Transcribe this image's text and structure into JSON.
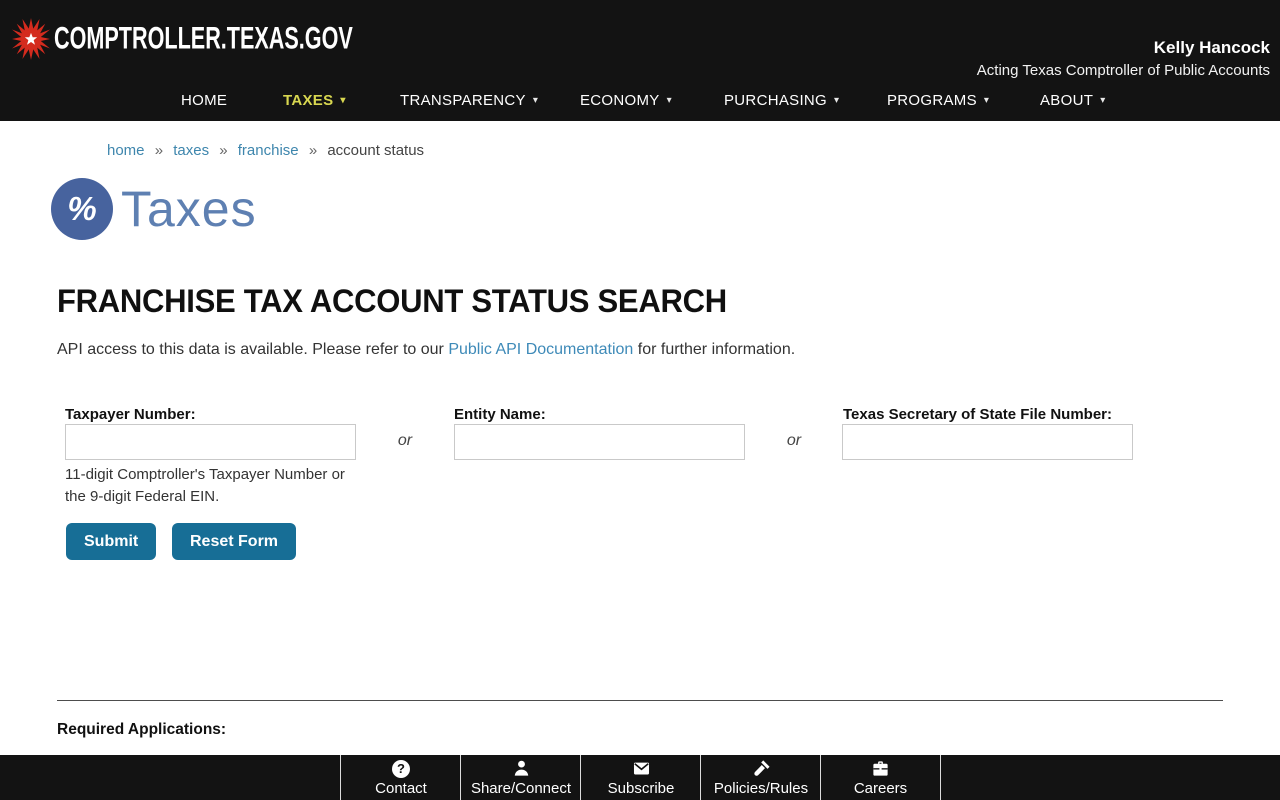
{
  "header": {
    "site_name": "COMPTROLLER.TEXAS.GOV",
    "official": {
      "name": "Kelly Hancock",
      "title": "Acting Texas Comptroller of Public Accounts"
    },
    "nav": [
      {
        "label": "HOME",
        "active": false,
        "dropdown": false
      },
      {
        "label": "TAXES",
        "active": true,
        "dropdown": true
      },
      {
        "label": "TRANSPARENCY",
        "active": false,
        "dropdown": true
      },
      {
        "label": "ECONOMY",
        "active": false,
        "dropdown": true
      },
      {
        "label": "PURCHASING",
        "active": false,
        "dropdown": true
      },
      {
        "label": "PROGRAMS",
        "active": false,
        "dropdown": true
      },
      {
        "label": "ABOUT",
        "active": false,
        "dropdown": true
      }
    ]
  },
  "breadcrumb": {
    "separator": "»",
    "links": [
      "home",
      "taxes",
      "franchise"
    ],
    "current": "account status"
  },
  "banner": {
    "icon_glyph": "%",
    "title": "Taxes"
  },
  "main": {
    "title": "FRANCHISE TAX ACCOUNT STATUS SEARCH",
    "intro": {
      "before_link": "API access to this data is available. Please refer to our ",
      "link_text": "Public API Documentation",
      "after_link": " for further information."
    },
    "form": {
      "separator_text": "or",
      "fields": [
        {
          "label": "Taxpayer Number:",
          "value": "",
          "help": "11-digit Comptroller's Taxpayer Number or the 9-digit Federal EIN."
        },
        {
          "label": "Entity Name:",
          "value": ""
        },
        {
          "label": "Texas Secretary of State File Number:",
          "value": ""
        }
      ],
      "buttons": {
        "submit": "Submit",
        "reset": "Reset Form"
      }
    },
    "required_applications_label": "Required Applications:"
  },
  "footer": {
    "items": [
      {
        "label": "Contact",
        "icon": "question-circle-icon",
        "glyph": "?"
      },
      {
        "label": "Share/Connect",
        "icon": "person-icon"
      },
      {
        "label": "Subscribe",
        "icon": "envelope-icon"
      },
      {
        "label": "Policies/Rules",
        "icon": "gavel-icon"
      },
      {
        "label": "Careers",
        "icon": "briefcase-icon"
      }
    ]
  },
  "colors": {
    "header_bg": "#131313",
    "nav_active": "#d8d750",
    "link_blue": "#3e8ab8",
    "banner_circle": "#47639e",
    "banner_title": "#5e80b2",
    "button_bg": "#176e96",
    "logo_red": "#d42b1e"
  }
}
